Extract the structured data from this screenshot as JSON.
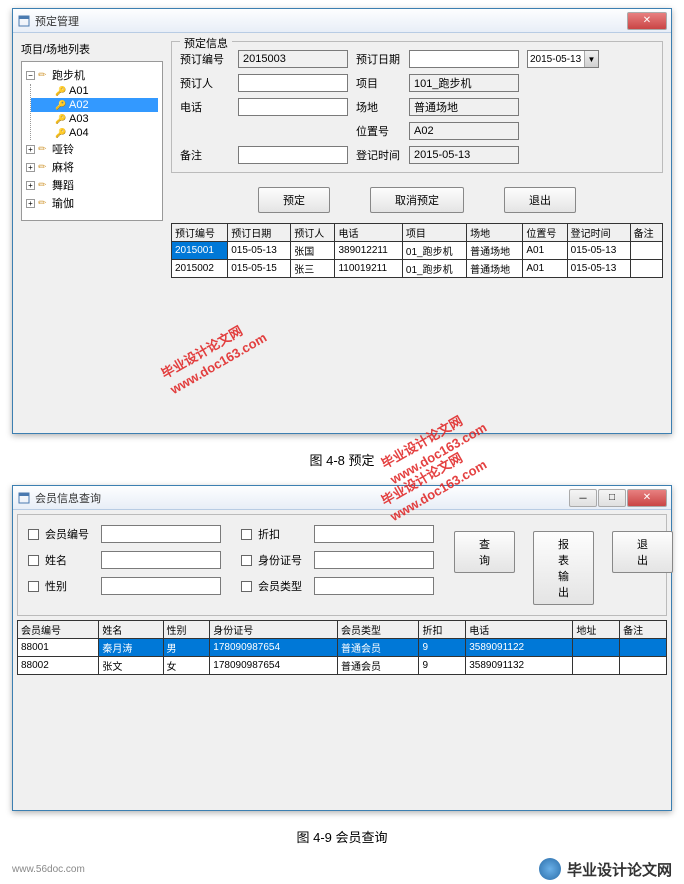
{
  "window1": {
    "title": "预定管理",
    "treeLabel": "项目/场地列表",
    "tree": {
      "root": "跑步机",
      "children": [
        "A01",
        "A02",
        "A03",
        "A04"
      ],
      "selectedIndex": 1,
      "siblings": [
        "哑铃",
        "麻将",
        "舞蹈",
        "瑜伽"
      ]
    },
    "group": {
      "title": "预定信息",
      "labels": {
        "bookingNo": "预订编号",
        "bookingDate": "预订日期",
        "person": "预订人",
        "project": "项目",
        "phone": "电话",
        "venue": "场地",
        "positionNo": "位置号",
        "remarks": "备注",
        "regTime": "登记时间"
      },
      "values": {
        "bookingNo": "2015003",
        "dateCombo": "2015-05-13",
        "project": "101_跑步机",
        "venue": "普通场地",
        "positionNo": "A02",
        "regTime": "2015-05-13"
      }
    },
    "buttons": {
      "book": "预定",
      "cancel": "取消预定",
      "exit": "退出"
    },
    "table": {
      "headers": [
        "预订编号",
        "预订日期",
        "预订人",
        "电话",
        "项目",
        "场地",
        "位置号",
        "登记时间",
        "备注"
      ],
      "rows": [
        [
          "2015001",
          "015-05-13",
          "张国",
          "389012211",
          "01_跑步机",
          "普通场地",
          "A01",
          "015-05-13",
          ""
        ],
        [
          "2015002",
          "015-05-15",
          "张三",
          "110019211",
          "01_跑步机",
          "普通场地",
          "A01",
          "015-05-13",
          ""
        ]
      ]
    }
  },
  "caption1": "图 4-8 预定",
  "window2": {
    "title": "会员信息查询",
    "winControls": {
      "min": "－",
      "max": "□",
      "close": "✕"
    },
    "search": {
      "labels": {
        "memberNo": "会员编号",
        "name": "姓名",
        "gender": "性别",
        "discount": "折扣",
        "idNo": "身份证号",
        "memberType": "会员类型"
      },
      "buttons": {
        "query": "查询",
        "report": "报表输出",
        "exit": "退出"
      }
    },
    "table": {
      "headers": [
        "会员编号",
        "姓名",
        "性别",
        "身份证号",
        "会员类型",
        "折扣",
        "电话",
        "地址",
        "备注"
      ],
      "rows": [
        [
          "88001",
          "秦月涛",
          "男",
          "178090987654",
          "普通会员",
          "9",
          "3589091122",
          "",
          ""
        ],
        [
          "88002",
          "张文",
          "女",
          "178090987654",
          "普通会员",
          "9",
          "3589091132",
          "",
          ""
        ]
      ]
    }
  },
  "caption2": "图 4-9 会员查询",
  "watermark": {
    "line1": "毕业设计论文网",
    "line2": "www.doc163.com"
  },
  "footer": {
    "brand": "毕业设计论文网",
    "url": "www.56doc.com"
  }
}
